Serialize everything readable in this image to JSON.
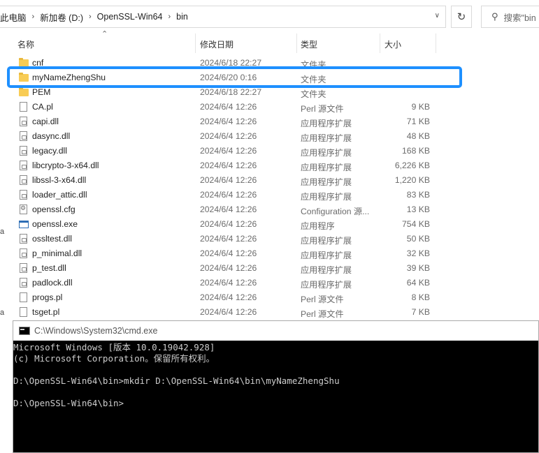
{
  "address_bar": {
    "segments": [
      "此电脑",
      "新加卷 (D:)",
      "OpenSSL-Win64",
      "bin"
    ],
    "separator": "›"
  },
  "search": {
    "placeholder": "搜索\"bin"
  },
  "columns": {
    "name": "名称",
    "date": "修改日期",
    "type": "类型",
    "size": "大小"
  },
  "files": [
    {
      "name": "cnf",
      "date": "2024/6/18 22:27",
      "type": "文件夹",
      "size": "",
      "icon": "folder-icon"
    },
    {
      "name": "myNameZhengShu",
      "date": "2024/6/20 0:16",
      "type": "文件夹",
      "size": "",
      "icon": "folder-icon"
    },
    {
      "name": "PEM",
      "date": "2024/6/18 22:27",
      "type": "文件夹",
      "size": "",
      "icon": "folder-icon"
    },
    {
      "name": "CA.pl",
      "date": "2024/6/4 12:26",
      "type": "Perl 源文件",
      "size": "9 KB",
      "icon": "file-icon"
    },
    {
      "name": "capi.dll",
      "date": "2024/6/4 12:26",
      "type": "应用程序扩展",
      "size": "71 KB",
      "icon": "dll-icon"
    },
    {
      "name": "dasync.dll",
      "date": "2024/6/4 12:26",
      "type": "应用程序扩展",
      "size": "48 KB",
      "icon": "dll-icon"
    },
    {
      "name": "legacy.dll",
      "date": "2024/6/4 12:26",
      "type": "应用程序扩展",
      "size": "168 KB",
      "icon": "dll-icon"
    },
    {
      "name": "libcrypto-3-x64.dll",
      "date": "2024/6/4 12:26",
      "type": "应用程序扩展",
      "size": "6,226 KB",
      "icon": "dll-icon"
    },
    {
      "name": "libssl-3-x64.dll",
      "date": "2024/6/4 12:26",
      "type": "应用程序扩展",
      "size": "1,220 KB",
      "icon": "dll-icon"
    },
    {
      "name": "loader_attic.dll",
      "date": "2024/6/4 12:26",
      "type": "应用程序扩展",
      "size": "83 KB",
      "icon": "dll-icon"
    },
    {
      "name": "openssl.cfg",
      "date": "2024/6/4 12:26",
      "type": "Configuration 源...",
      "size": "13 KB",
      "icon": "config-icon"
    },
    {
      "name": "openssl.exe",
      "date": "2024/6/4 12:26",
      "type": "应用程序",
      "size": "754 KB",
      "icon": "exe-icon"
    },
    {
      "name": "ossltest.dll",
      "date": "2024/6/4 12:26",
      "type": "应用程序扩展",
      "size": "50 KB",
      "icon": "dll-icon"
    },
    {
      "name": "p_minimal.dll",
      "date": "2024/6/4 12:26",
      "type": "应用程序扩展",
      "size": "32 KB",
      "icon": "dll-icon"
    },
    {
      "name": "p_test.dll",
      "date": "2024/6/4 12:26",
      "type": "应用程序扩展",
      "size": "39 KB",
      "icon": "dll-icon"
    },
    {
      "name": "padlock.dll",
      "date": "2024/6/4 12:26",
      "type": "应用程序扩展",
      "size": "64 KB",
      "icon": "dll-icon"
    },
    {
      "name": "progs.pl",
      "date": "2024/6/4 12:26",
      "type": "Perl 源文件",
      "size": "8 KB",
      "icon": "file-icon"
    },
    {
      "name": "tsget.pl",
      "date": "2024/6/4 12:26",
      "type": "Perl 源文件",
      "size": "7 KB",
      "icon": "file-icon"
    }
  ],
  "selected_file": "myNameZhengShu",
  "highlight_color": "#1e90ff",
  "left_pane_marks": [
    "a",
    "a"
  ],
  "cmd": {
    "title": "C:\\Windows\\System32\\cmd.exe",
    "lines": [
      "Microsoft Windows [版本 10.0.19042.928]",
      "(c) Microsoft Corporation。保留所有权利。",
      "",
      "D:\\OpenSSL-Win64\\bin>mkdir D:\\OpenSSL-Win64\\bin\\myNameZhengShu",
      "",
      "D:\\OpenSSL-Win64\\bin>"
    ]
  }
}
